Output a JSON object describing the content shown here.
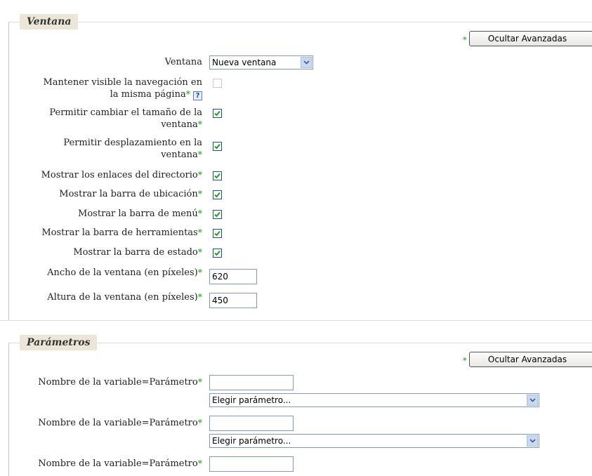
{
  "sections": {
    "ventana": {
      "legend": "Ventana",
      "advanced_button": "Ocultar Avanzadas"
    },
    "parametros": {
      "legend": "Parámetros",
      "advanced_button": "Ocultar Avanzadas"
    }
  },
  "ventana_fields": {
    "ventana": {
      "label": "Ventana",
      "value": "Nueva ventana"
    },
    "mantener": {
      "label_l1": "Mantener visible la navegación en",
      "label_l2": "la misma página",
      "checked": false,
      "disabled": true
    },
    "cambiar_tamano": {
      "label_l1": "Permitir cambiar el tamaño de la",
      "label_l2": "ventana",
      "checked": true
    },
    "desplazamiento": {
      "label_l1": "Permitir desplazamiento en la",
      "label_l2": "ventana",
      "checked": true
    },
    "directorio": {
      "label": "Mostrar los enlaces del directorio",
      "checked": true
    },
    "ubicacion": {
      "label": "Mostrar la barra de ubicación",
      "checked": true
    },
    "menu": {
      "label": "Mostrar la barra de menú",
      "checked": true
    },
    "herramientas": {
      "label": "Mostrar la barra de herramientas",
      "checked": true
    },
    "estado": {
      "label": "Mostrar la barra de estado",
      "checked": true
    },
    "ancho": {
      "label": "Ancho de la ventana (en píxeles)",
      "value": "620"
    },
    "altura": {
      "label": "Altura de la ventana (en píxeles)",
      "value": "450"
    }
  },
  "parametros_fields": {
    "param_label": "Nombre de la variable=Parámetro",
    "select_placeholder": "Elegir parámetro..."
  },
  "required_marker": "*",
  "help_glyph": "?",
  "icons": {
    "checkbox_check": "check-icon",
    "select_arrow": "chevron-down-icon",
    "help": "help-icon"
  },
  "colors": {
    "required_star": "#33aa33",
    "legend_bg": "#ebe6d8",
    "checkbox_border": "#1c5180",
    "check_mark": "#21a121"
  }
}
